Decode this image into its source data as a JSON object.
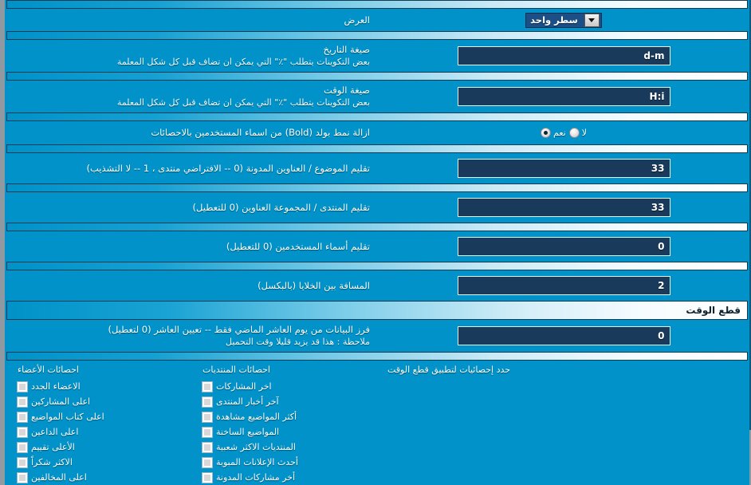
{
  "rows": {
    "display": {
      "label": "العرض",
      "select_value": "سطر واحد"
    },
    "date_format": {
      "label": "صيغة التاريخ",
      "hint": "بعض التكوينات يتطلب \"٪\" التي يمكن ان تضاف قبل كل شكل المعلمة",
      "value": "d-m"
    },
    "time_format": {
      "label": "صيغة الوقت",
      "hint": "بعض التكوينات يتطلب \"٪\" التي يمكن ان تضاف قبل كل شكل المعلمة",
      "value": "H:i"
    },
    "remove_bold": {
      "label": "ازالة نمط بولد (Bold) من اسماء المستخدمين بالاحصائات",
      "yes_label": "نعم",
      "no_label": "لا",
      "selected": "yes"
    },
    "trim_topic": {
      "label": "تقليم الموضوع / العناوين المدونة (0 -- الافتراضي منتدى ، 1 -- لا التشذيب)",
      "value": "33"
    },
    "trim_forum": {
      "label": "تقليم المنتدى / المجموعة العناوين (0 للتعطيل)",
      "value": "33"
    },
    "trim_username": {
      "label": "تقليم أسماء المستخدمين (0 للتعطيل)",
      "value": "0"
    },
    "cell_spacing": {
      "label": "المسافة بين الخلايا (بالبكسل)",
      "value": "2"
    },
    "timecut_header": {
      "label": "قطع الوقت"
    },
    "timecut_days": {
      "label": "فرز البيانات من يوم العاشر الماضي فقط -- تعيين العاشر (0 لتعطيل)",
      "hint": "ملاحظة : هذا قد يزيد قليلا وقت التحميل",
      "value": "0"
    }
  },
  "panel": {
    "right_label": "حدد إحصائيات لتطبيق قطع الوقت",
    "forum_stats": {
      "title": "احصائات المنتديات",
      "items": [
        {
          "label": "اخر المشاركات",
          "checked": false
        },
        {
          "label": "آخر أخبار المنتدى",
          "checked": false
        },
        {
          "label": "أكثر المواضيع مشاهدة",
          "checked": false
        },
        {
          "label": "المواضيع الساخنة",
          "checked": false
        },
        {
          "label": "المنتديات الاكثر شعبية",
          "checked": false
        },
        {
          "label": "أحدث الإعلانات المبوبة",
          "checked": false
        },
        {
          "label": "أخر مشاركات المدونة",
          "checked": false
        }
      ]
    },
    "member_stats": {
      "title": "احصائات الأعضاء",
      "items": [
        {
          "label": "الاعضاء الجدد",
          "checked": false
        },
        {
          "label": "اعلى المشاركين",
          "checked": false
        },
        {
          "label": "اعلى كتاب المواضيع",
          "checked": false
        },
        {
          "label": "اعلى الداعين",
          "checked": false
        },
        {
          "label": "الأعلى تقييم",
          "checked": false
        },
        {
          "label": "الاكثر شكراً",
          "checked": false
        },
        {
          "label": "اعلى المخالفين",
          "checked": false
        }
      ]
    }
  },
  "colors": {
    "background": "#0092c8",
    "input_bg": "#1a3a5c",
    "border": "#123b52",
    "text": "#ffffff"
  }
}
